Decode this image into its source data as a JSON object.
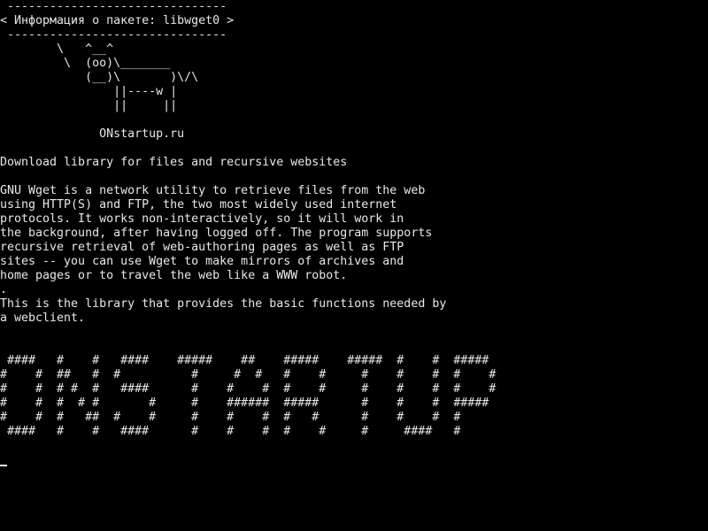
{
  "colors": {
    "background": "#000000",
    "foreground": "#e8e8e8"
  },
  "cowsay": {
    "border_top": "-------------------------------",
    "title": "< Информация о пакете: libwget0 >",
    "border_bottom": " -------------------------------",
    "art": [
      "        \\   ^__^",
      "         \\  (oo)\\_______",
      "            (__)\\       )\\/\\",
      "                ||----w |",
      "                ||     ||"
    ]
  },
  "site_label": "              ONstartup.ru",
  "summary": "Download library for files and recursive websites",
  "description": [
    "GNU Wget is a network utility to retrieve files from the web",
    "using HTTP(S) and FTP, the two most widely used internet",
    "protocols. It works non-interactively, so it will work in",
    "the background, after having logged off. The program supports",
    "recursive retrieval of web-authoring pages as well as FTP",
    "sites -- you can use Wget to make mirrors of archives and",
    "home pages or to travel the web like a WWW robot."
  ],
  "separator_dot": ".",
  "library_note": [
    "This is the library that provides the basic functions needed by",
    "a webclient."
  ],
  "banner": [
    " ####   #    #   ####    #####    ##    #####    #####  #    #  #####",
    "#    #  ##   #  #          #     #  #   #    #     #    #    #  #    #",
    "#    #  # #  #   ####      #    #    #  #    #     #    #    #  #    #",
    "#    #  #  # #       #     #    ######  #####      #    #    #  #####",
    "#    #  #   ##  #    #     #    #    #  #   #      #    #    #  #",
    " ####   #    #   ####      #    #    #  #    #     #     ####   #"
  ]
}
